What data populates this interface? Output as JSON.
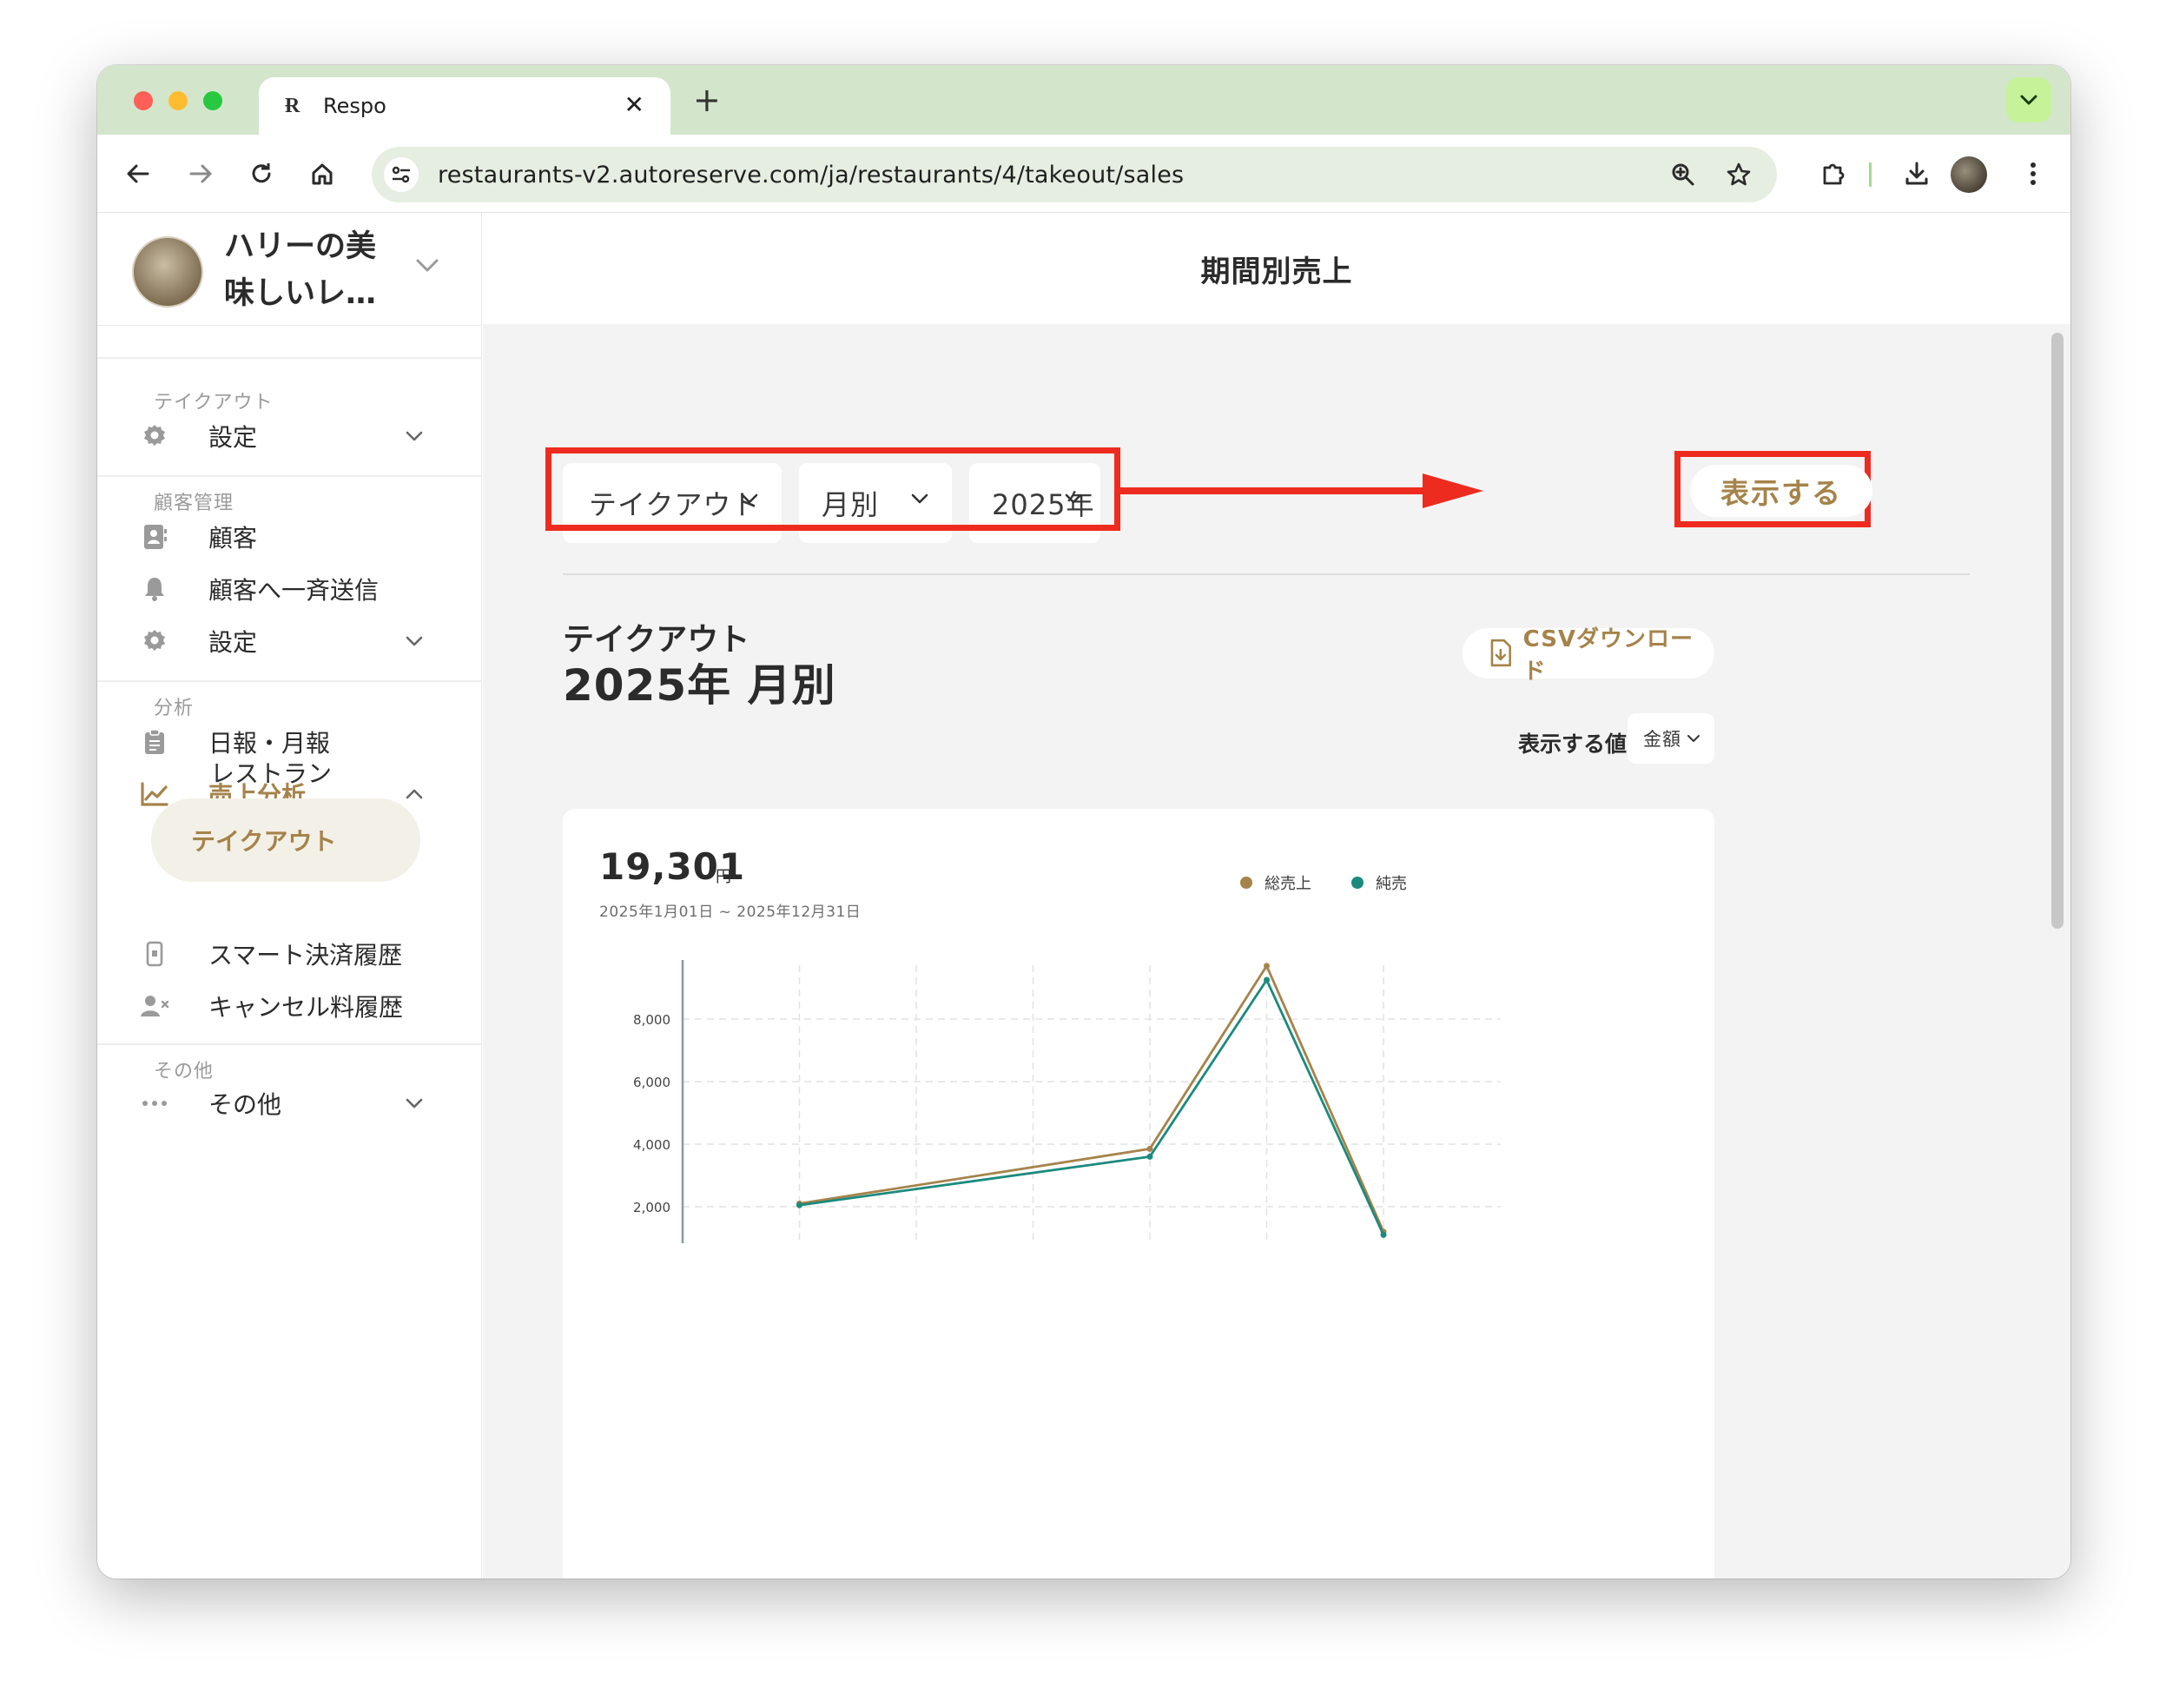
{
  "browser": {
    "tab_title": "Respo",
    "url": "restaurants-v2.autoreserve.com/ja/restaurants/4/takeout/sales",
    "tab_close": "✕",
    "new_tab": "+"
  },
  "sidebar": {
    "shop_name": "ハリーの美味しいレ…",
    "sections": {
      "takeout": "テイクアウト",
      "customer": "顧客管理",
      "analysis": "分析",
      "other": "その他"
    },
    "items": {
      "takeout_settings": "設定",
      "customers": "顧客",
      "broadcast": "顧客へ一斉送信",
      "customer_settings": "設定",
      "daily_monthly": "日報・月報",
      "sales_analysis": "売上分析",
      "restaurant": "レストラン",
      "takeout": "テイクアウト",
      "smart_payment": "スマート決済履歴",
      "cancel_fee": "キャンセル料履歴",
      "other": "その他"
    }
  },
  "main": {
    "page_title": "期間別売上",
    "filters": {
      "type": "テイクアウト",
      "period": "月別",
      "year": "2025年"
    },
    "show_button": "表示する",
    "report_kind": "テイクアウト",
    "report_period": "2025年 月別",
    "csv_button": "CSVダウンロード",
    "value_label": "表示する値",
    "metric": "金額",
    "total": "19,301",
    "total_unit": "円",
    "range": "2025年1月01日 ~ 2025年12月31日"
  },
  "colors": {
    "accent": "#a5834a",
    "gross": "#a5834a",
    "net": "#1a8a7e",
    "highlight": "#ee2b1f"
  },
  "chart_data": {
    "type": "line",
    "series": [
      {
        "name": "総売上",
        "values": [
          null,
          2100,
          null,
          null,
          3850,
          9700,
          1200
        ]
      },
      {
        "name": "純売",
        "values": [
          null,
          2050,
          null,
          null,
          3600,
          9250,
          1100
        ]
      }
    ],
    "y_ticks": [
      "2,000",
      "4,000",
      "6,000",
      "8,000"
    ],
    "y_tick_values": [
      2000,
      4000,
      6000,
      8000
    ],
    "ylim": [
      0,
      10000
    ],
    "grid": true,
    "legend_position": "top-right"
  }
}
